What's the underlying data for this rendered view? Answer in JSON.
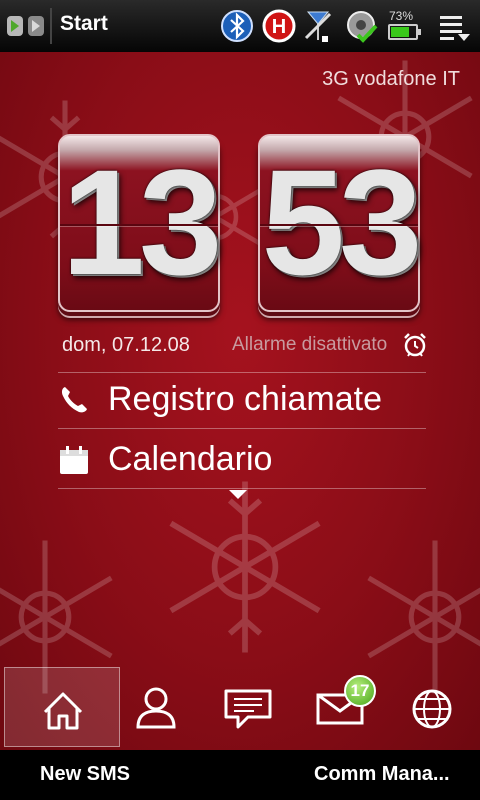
{
  "title_bar": {
    "title": "Start"
  },
  "status": {
    "battery_percent": "73%",
    "battery_level": 0.73,
    "icons": [
      "bluetooth-icon",
      "hsdpa-icon",
      "signal-icon",
      "sync-icon",
      "battery-icon",
      "menu-icon"
    ]
  },
  "home": {
    "operator": "3G vodafone IT",
    "clock": {
      "hours": "13",
      "minutes": "53"
    },
    "date": "dom, 07.12.08",
    "alarm": "Allarme disattivato",
    "items": [
      {
        "label": "Registro chiamate",
        "icon": "phone-icon"
      },
      {
        "label": "Calendario",
        "icon": "calendar-icon"
      }
    ]
  },
  "dock": {
    "tabs": [
      "home-icon",
      "person-icon",
      "chat-icon",
      "mail-icon",
      "globe-icon"
    ],
    "mail_badge": "17"
  },
  "softkeys": {
    "left": "New SMS",
    "right": "Comm Mana..."
  },
  "colors": {
    "background": "#8a0d17",
    "accent": "#39c81a"
  }
}
